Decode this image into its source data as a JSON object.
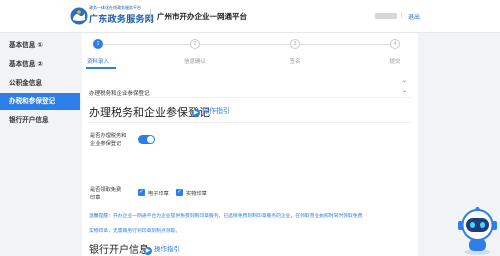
{
  "header": {
    "logo_small": "政务一体化在线政务服务平台",
    "logo_title": "广东政务服务网",
    "platform_title": "广州市开办企业一网通平台",
    "logout": "退出"
  },
  "sidebar": {
    "items": [
      {
        "label": "基本信息 ①"
      },
      {
        "label": "基本信息 ②"
      },
      {
        "label": "公积金信息"
      },
      {
        "label": "办税和参保登记"
      },
      {
        "label": "银行开户信息"
      }
    ]
  },
  "steps": [
    {
      "num": "1",
      "label": "资料录入"
    },
    {
      "num": "2",
      "label": "信息确认"
    },
    {
      "num": "3",
      "label": "签名"
    },
    {
      "num": "4",
      "label": "提交"
    }
  ],
  "main": {
    "section_header": "办理税务和企业参保登记",
    "title": "办理税务和企业参保登记",
    "guide": "操作指引",
    "insurance_label_line1": "是否办理税务和",
    "insurance_label_line2": "企业参保登记",
    "invoice_label_line1": "是否领取免费",
    "invoice_label_line2": "印章",
    "option_electronic": "电子印章",
    "option_physical": "实物印章",
    "notice_line1": "温馨提醒：开办企业一网通平台为企业提供免费刻制印章服务，已选择免费刻制印章服务的企业，在领取营业执照时同时领取免费",
    "notice_line2": "实物印章，无需再另行到印章刻制点领取。",
    "next_title": "银行开户信息",
    "next_guide": "操作指引"
  },
  "icons": {
    "logo": "guangdong-gov-logo-icon",
    "chevron": "chevron-down-icon",
    "guide": "guide-play-icon",
    "check": "check-icon",
    "robot": "robot-assistant-icon"
  },
  "colors": {
    "accent": "#2d7ee8",
    "brand": "#1e5aa8"
  }
}
